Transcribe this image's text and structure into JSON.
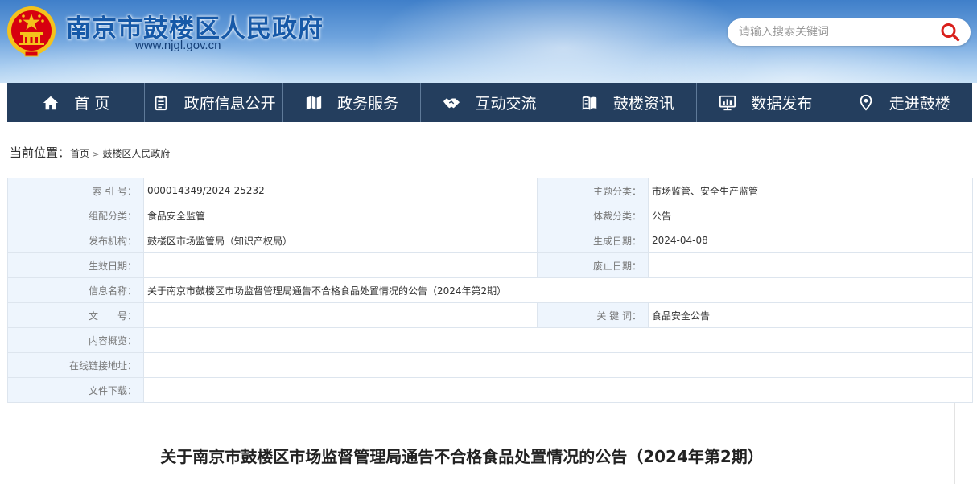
{
  "header": {
    "site_title": "南京市鼓楼区人民政府",
    "site_domain": "www.njgl.gov.cn",
    "search_placeholder": "请输入搜索关键词"
  },
  "nav": {
    "items": [
      {
        "label": "首 页",
        "icon": "home-icon"
      },
      {
        "label": "政府信息公开",
        "icon": "document-icon"
      },
      {
        "label": "政务服务",
        "icon": "map-icon"
      },
      {
        "label": "互动交流",
        "icon": "handshake-icon"
      },
      {
        "label": "鼓楼资讯",
        "icon": "book-icon"
      },
      {
        "label": "数据发布",
        "icon": "chart-icon"
      },
      {
        "label": "走进鼓楼",
        "icon": "location-icon"
      }
    ]
  },
  "breadcrumb": {
    "prefix": "当前位置：",
    "links": [
      "首页",
      "鼓楼区人民政府"
    ]
  },
  "meta": {
    "index_no_label": "索 引 号：",
    "index_no": "000014349/2024-25232",
    "topic_label": "主题分类：",
    "topic": "市场监管、安全生产监管",
    "org_cat_label": "组配分类：",
    "org_cat": "食品安全监管",
    "genre_label": "体裁分类：",
    "genre": "公告",
    "publisher_label": "发布机构：",
    "publisher": "鼓楼区市场监管局（知识产权局）",
    "created_label": "生成日期：",
    "created": "2024-04-08",
    "effective_label": "生效日期：",
    "effective": "",
    "abolished_label": "废止日期：",
    "abolished": "",
    "info_name_label": "信息名称：",
    "info_name": "关于南京市鼓楼区市场监督管理局通告不合格食品处置情况的公告（2024年第2期）",
    "doc_no_label": "文　　号：",
    "doc_no": "",
    "keywords_label": "关 键 词：",
    "keywords": "食品安全公告",
    "summary_label": "内容概览：",
    "summary": "",
    "online_link_label": "在线链接地址：",
    "online_link": "",
    "download_label": "文件下载：",
    "download": ""
  },
  "article": {
    "title": "关于南京市鼓楼区市场监督管理局通告不合格食品处置情况的公告（2024年第2期）"
  },
  "colors": {
    "nav_bg": "#243e5e",
    "title_blue": "#1659a8",
    "meta_key_bg": "#eef5fd",
    "search_icon": "#d9201c",
    "emblem_red": "#d7000f",
    "emblem_gold": "#f4c21c"
  }
}
